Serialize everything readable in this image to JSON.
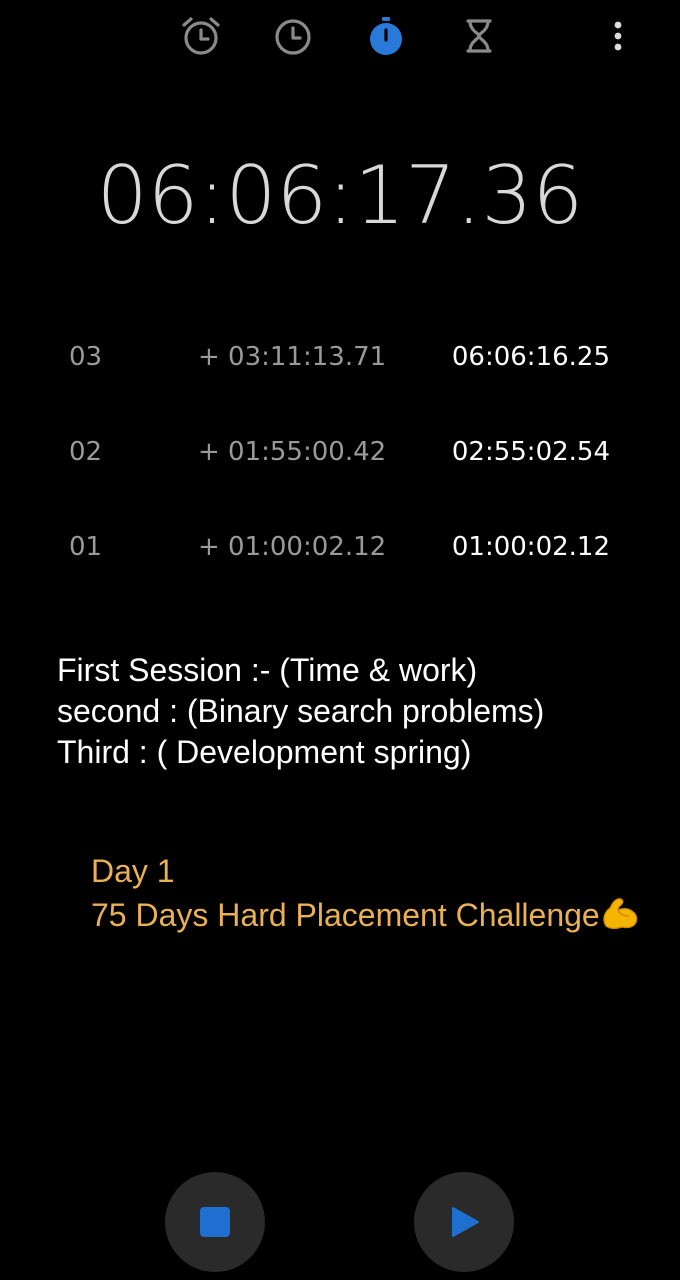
{
  "app": {
    "accent_color": "#2979d9",
    "inactive_icon_color": "#8a8a8a"
  },
  "tabs": [
    {
      "name": "Alarm",
      "icon": "alarm-clock-icon",
      "active": false
    },
    {
      "name": "Clock",
      "icon": "clock-icon",
      "active": false
    },
    {
      "name": "Stopwatch",
      "icon": "stopwatch-icon",
      "active": true
    },
    {
      "name": "Timer",
      "icon": "hourglass-icon",
      "active": false
    }
  ],
  "menu_icon": "more-vertical-icon",
  "stopwatch": {
    "time": "06:06:17.36"
  },
  "laps": [
    {
      "number": "03",
      "diff": "+ 03:11:13.71",
      "total": "06:06:16.25"
    },
    {
      "number": "02",
      "diff": "+ 01:55:00.42",
      "total": "02:55:02.54"
    },
    {
      "number": "01",
      "diff": "+ 01:00:02.12",
      "total": "01:00:02.12"
    }
  ],
  "notes": {
    "line1": "First Session :-  (Time & work)",
    "line2": "second : (Binary search problems)",
    "line3": "Third : ( Development spring)"
  },
  "challenge": {
    "line1": "Day 1",
    "line2": "75 Days Hard Placement Challenge",
    "emoji": "flexed-biceps-emoji",
    "color": "#e9b055"
  },
  "controls": {
    "stop_icon": "stop-icon",
    "play_icon": "play-icon",
    "button_bg": "#2a2a2a",
    "icon_color": "#1f6fd1"
  }
}
